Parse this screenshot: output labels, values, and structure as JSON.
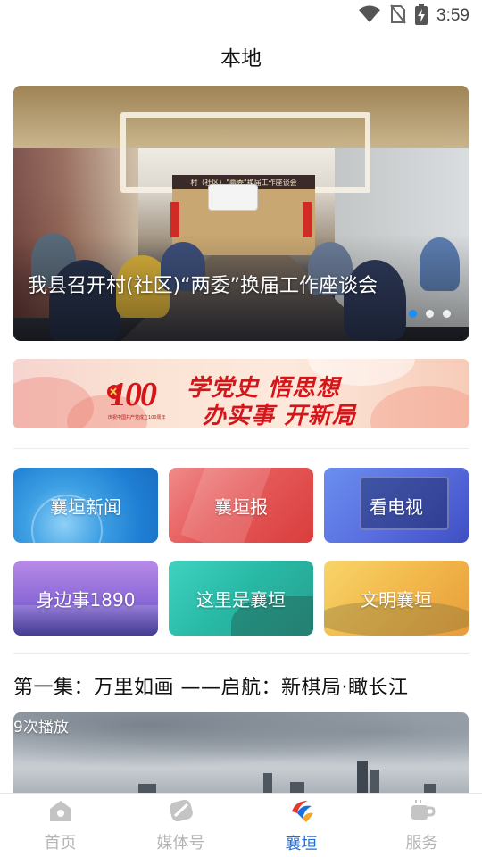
{
  "status_bar": {
    "time": "3:59",
    "icons": [
      "wifi-icon",
      "no-sim-icon",
      "battery-charging-icon"
    ]
  },
  "header": {
    "title": "本地"
  },
  "banner": {
    "title": "我县召开村(社区)“两委”换届工作座谈会",
    "stage_sign": "村（社区）\"两委\"换届工作座谈会",
    "slides_total": 3,
    "active_slide": 1
  },
  "promo": {
    "badge_number": "100",
    "badge_sub": "庆祝中国共产党成立100周年",
    "line1": "学党史 悟思想",
    "line2": "办实事 开新局"
  },
  "grid": {
    "tiles": [
      {
        "label": "襄垣新闻"
      },
      {
        "label": "襄垣报"
      },
      {
        "label": "看电视"
      },
      {
        "label": "身边事1890"
      },
      {
        "label": "这里是襄垣"
      },
      {
        "label": "文明襄垣"
      }
    ]
  },
  "video": {
    "title": "第一集：万里如画  ——启航：新棋局·瞰长江",
    "play_count": "9次播放"
  },
  "tabbar": {
    "tabs": [
      {
        "label": "首页",
        "icon": "home-icon"
      },
      {
        "label": "媒体号",
        "icon": "media-icon"
      },
      {
        "label": "襄垣",
        "icon": "xiangyuan-logo-icon"
      },
      {
        "label": "服务",
        "icon": "cup-icon"
      }
    ],
    "active": "襄垣"
  },
  "colors": {
    "accent": "#1a6fe0",
    "inactive_tab": "#b5b5b5",
    "promo_red": "#d4161a"
  }
}
